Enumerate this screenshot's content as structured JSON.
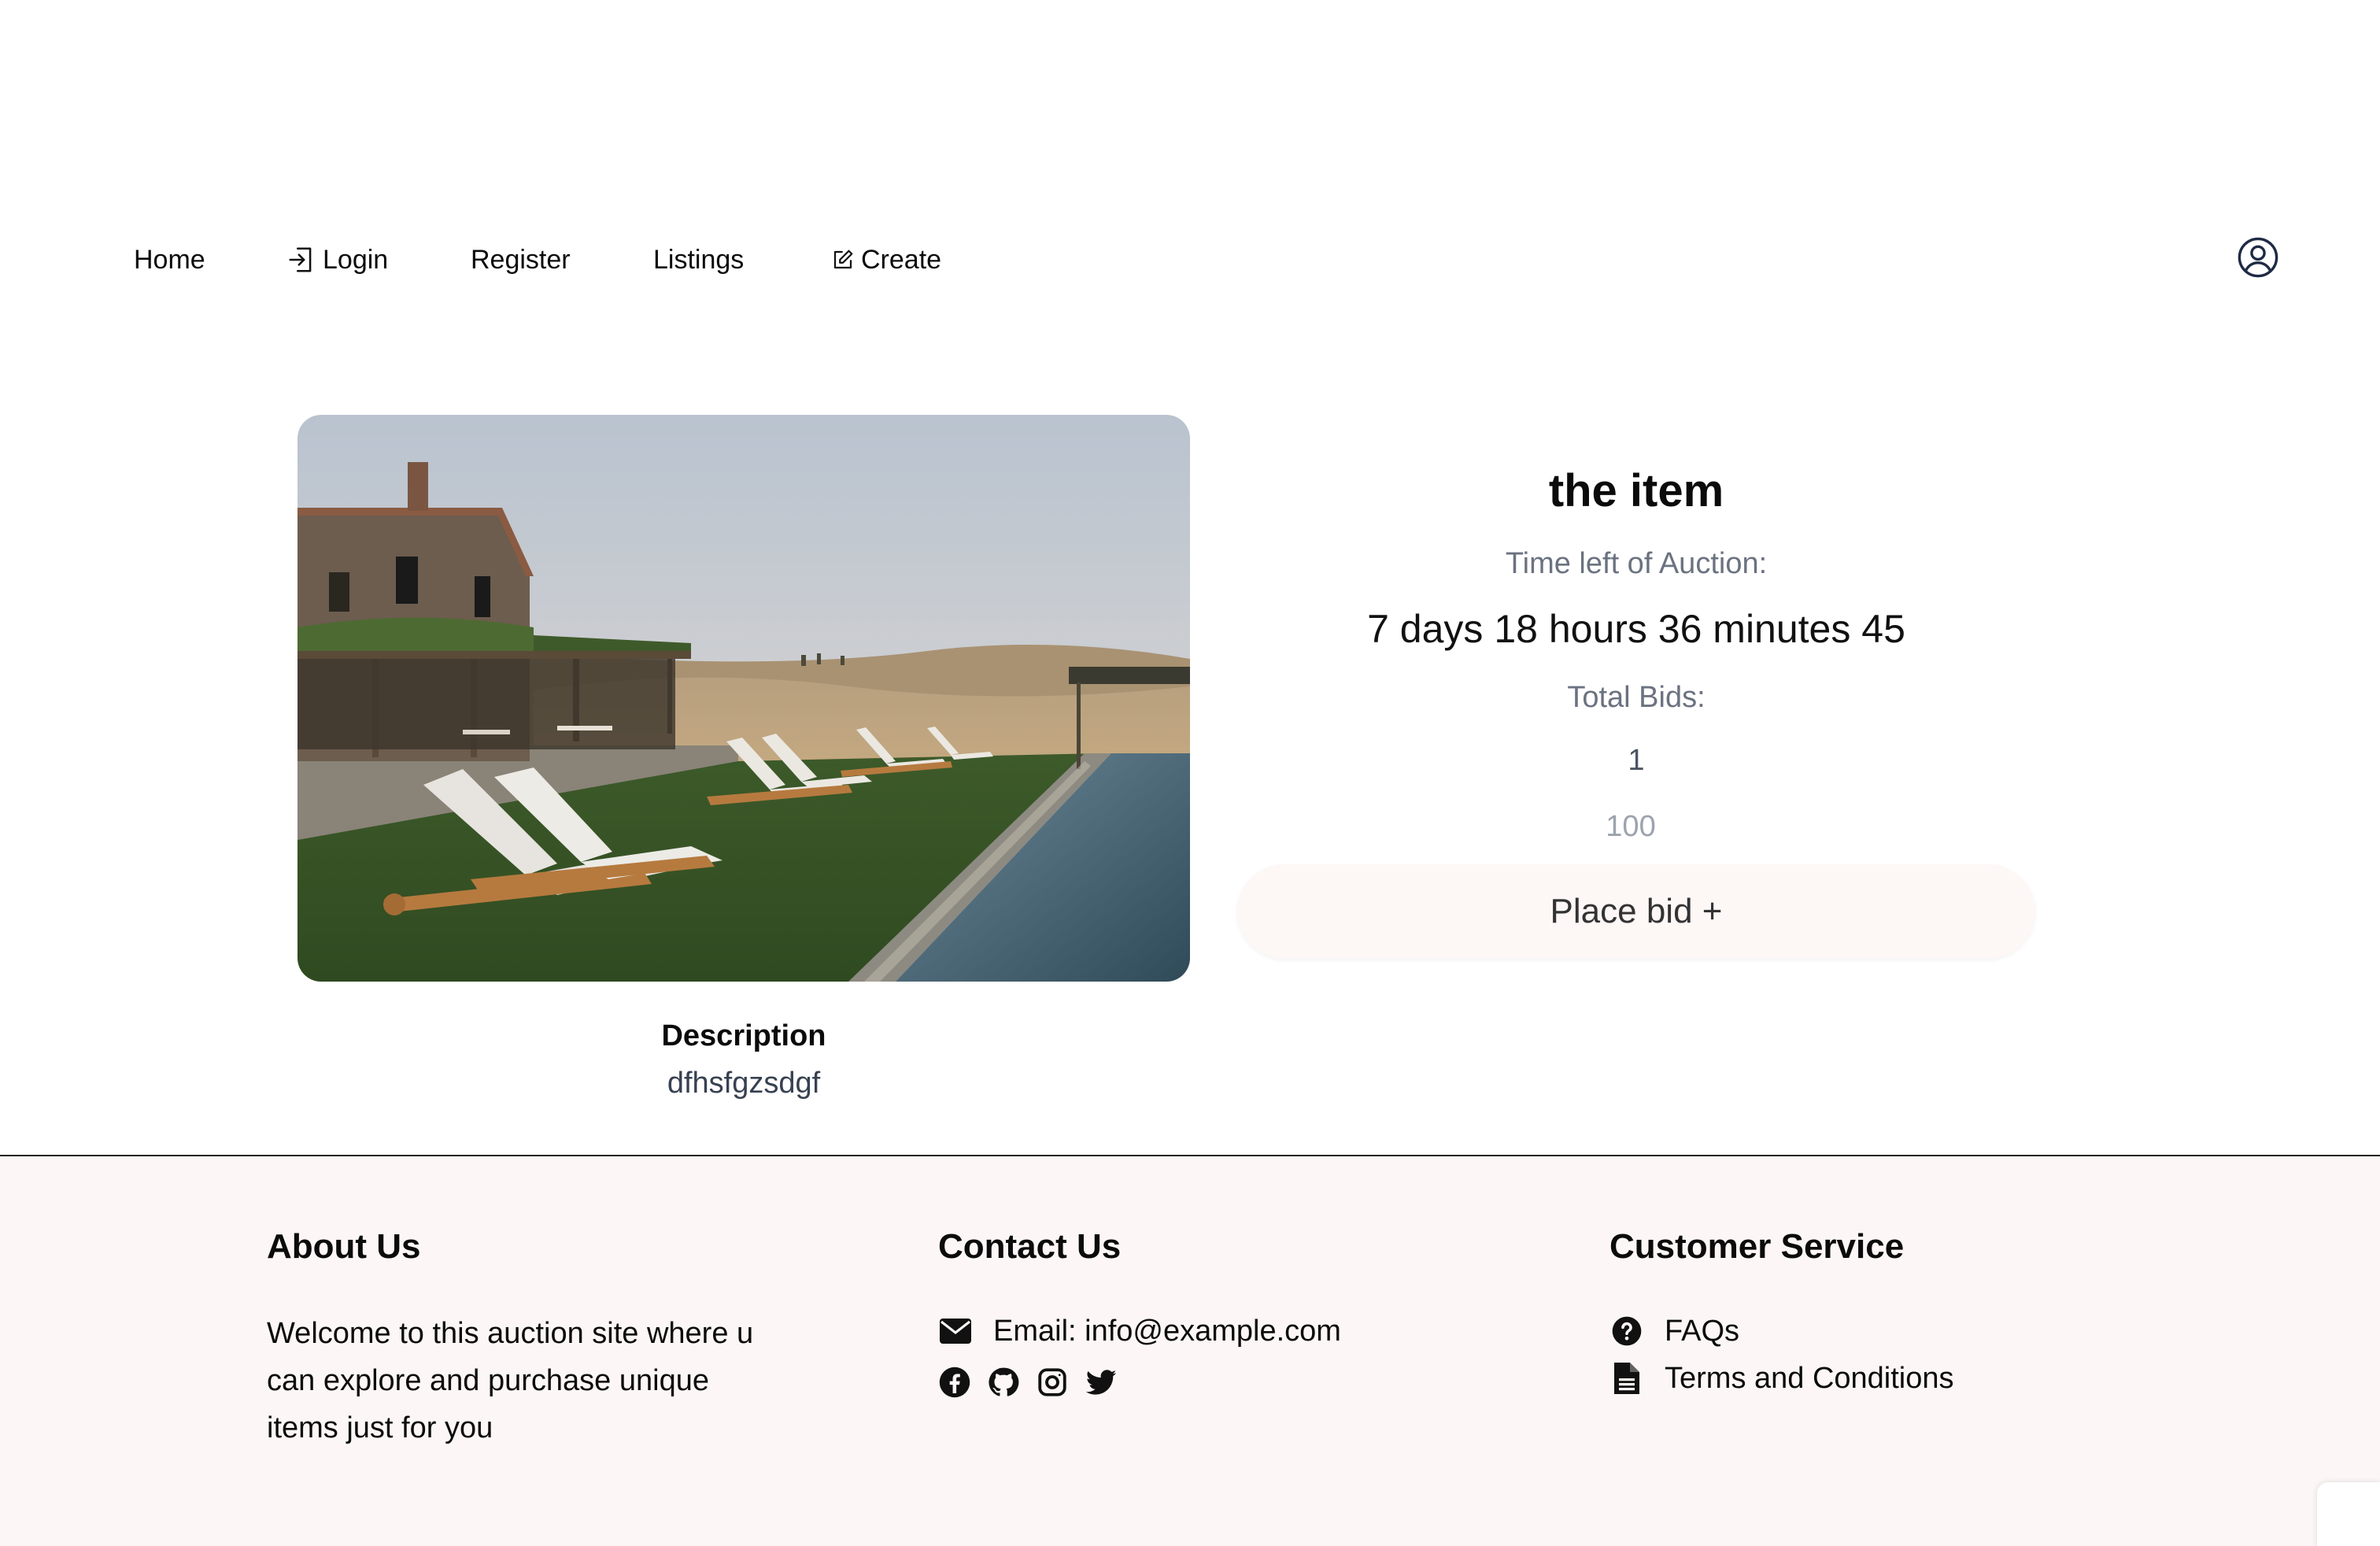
{
  "nav": {
    "home": "Home",
    "login": "Login",
    "register": "Register",
    "listings": "Listings",
    "create": "Create",
    "login_icon": "login-icon",
    "create_icon": "edit-icon",
    "user_icon": "user-circle-icon"
  },
  "listing": {
    "title": "the item",
    "time_left_label": "Time left of Auction:",
    "time_left_value": "7 days 18 hours 36 minutes 45",
    "total_bids_label": "Total Bids:",
    "total_bids_value": "1",
    "bid_placeholder": "100",
    "place_bid_label": "Place bid +",
    "description_label": "Description",
    "description_text": "dfhsfgzsdgf",
    "image_alt": "lounge-chairs-by-pool-photo"
  },
  "footer": {
    "about": {
      "heading": "About Us",
      "text": "Welcome to this auction site where u can explore and purchase unique items just for you"
    },
    "contact": {
      "heading": "Contact Us",
      "email": "Email: info@example.com",
      "socials": [
        "facebook-icon",
        "github-icon",
        "instagram-icon",
        "twitter-icon"
      ]
    },
    "service": {
      "heading": "Customer Service",
      "faqs": "FAQs",
      "terms": "Terms and Conditions"
    }
  },
  "colors": {
    "footer_bg": "#fcf7f6",
    "bid_button_bg": "#fdf7f6",
    "muted_text": "#6b7280"
  }
}
